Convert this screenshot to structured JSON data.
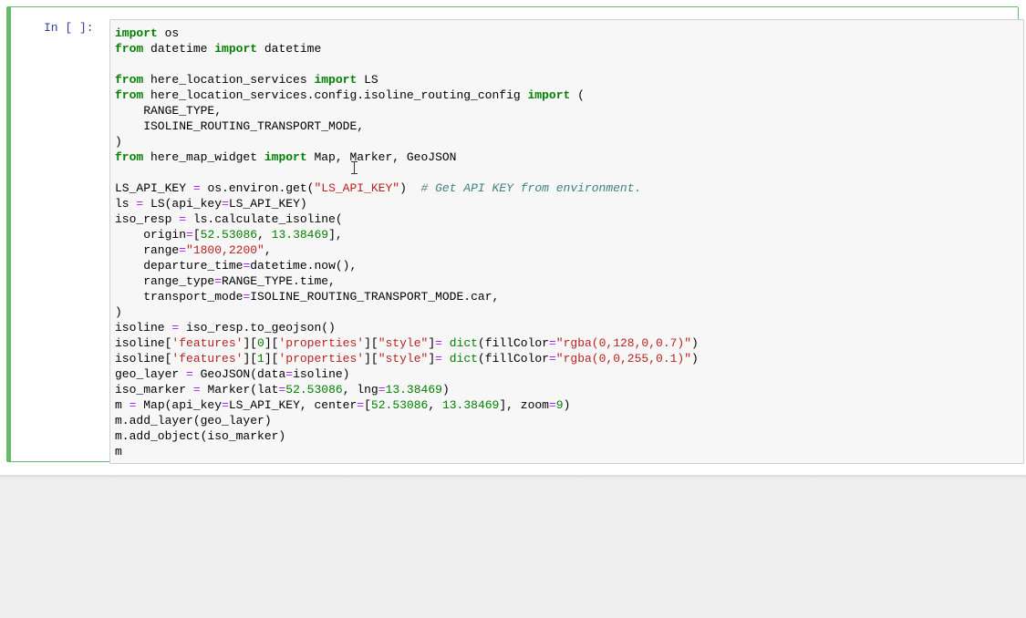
{
  "cell": {
    "prompt": "In [ ]:",
    "lines": [
      [
        [
          "keyword",
          "import"
        ],
        [
          "plain",
          " os"
        ]
      ],
      [
        [
          "keyword",
          "from"
        ],
        [
          "plain",
          " datetime "
        ],
        [
          "keyword",
          "import"
        ],
        [
          "plain",
          " datetime"
        ]
      ],
      [],
      [
        [
          "keyword",
          "from"
        ],
        [
          "plain",
          " here_location_services "
        ],
        [
          "keyword",
          "import"
        ],
        [
          "plain",
          " LS"
        ]
      ],
      [
        [
          "keyword",
          "from"
        ],
        [
          "plain",
          " here_location_services.config.isoline_routing_config "
        ],
        [
          "keyword",
          "import"
        ],
        [
          "plain",
          " ("
        ]
      ],
      [
        [
          "plain",
          "    RANGE_TYPE,"
        ]
      ],
      [
        [
          "plain",
          "    ISOLINE_ROUTING_TRANSPORT_MODE,"
        ]
      ],
      [
        [
          "plain",
          ")"
        ]
      ],
      [
        [
          "keyword",
          "from"
        ],
        [
          "plain",
          " here_map_widget "
        ],
        [
          "keyword",
          "import"
        ],
        [
          "plain",
          " Map, Marker, GeoJSON"
        ]
      ],
      [],
      [
        [
          "plain",
          "LS_API_KEY "
        ],
        [
          "op",
          "="
        ],
        [
          "plain",
          " os.environ.get("
        ],
        [
          "string",
          "\"LS_API_KEY\""
        ],
        [
          "plain",
          ")  "
        ],
        [
          "comment",
          "# Get API KEY from environment."
        ]
      ],
      [
        [
          "plain",
          "ls "
        ],
        [
          "op",
          "="
        ],
        [
          "plain",
          " LS(api_key"
        ],
        [
          "op",
          "="
        ],
        [
          "plain",
          "LS_API_KEY)"
        ]
      ],
      [
        [
          "plain",
          "iso_resp "
        ],
        [
          "op",
          "="
        ],
        [
          "plain",
          " ls.calculate_isoline("
        ]
      ],
      [
        [
          "plain",
          "    origin"
        ],
        [
          "op",
          "="
        ],
        [
          "plain",
          "["
        ],
        [
          "number",
          "52.53086"
        ],
        [
          "plain",
          ", "
        ],
        [
          "number",
          "13.38469"
        ],
        [
          "plain",
          "],"
        ]
      ],
      [
        [
          "plain",
          "    range"
        ],
        [
          "op",
          "="
        ],
        [
          "string",
          "\"1800,2200\""
        ],
        [
          "plain",
          ","
        ]
      ],
      [
        [
          "plain",
          "    departure_time"
        ],
        [
          "op",
          "="
        ],
        [
          "plain",
          "datetime.now(),"
        ]
      ],
      [
        [
          "plain",
          "    range_type"
        ],
        [
          "op",
          "="
        ],
        [
          "plain",
          "RANGE_TYPE.time,"
        ]
      ],
      [
        [
          "plain",
          "    transport_mode"
        ],
        [
          "op",
          "="
        ],
        [
          "plain",
          "ISOLINE_ROUTING_TRANSPORT_MODE.car,"
        ]
      ],
      [
        [
          "plain",
          ")"
        ]
      ],
      [
        [
          "plain",
          "isoline "
        ],
        [
          "op",
          "="
        ],
        [
          "plain",
          " iso_resp.to_geojson()"
        ]
      ],
      [
        [
          "plain",
          "isoline["
        ],
        [
          "string",
          "'features'"
        ],
        [
          "plain",
          "]["
        ],
        [
          "number",
          "0"
        ],
        [
          "plain",
          "]["
        ],
        [
          "string",
          "'properties'"
        ],
        [
          "plain",
          "]["
        ],
        [
          "string",
          "\"style\""
        ],
        [
          "plain",
          "]"
        ],
        [
          "op",
          "="
        ],
        [
          "plain",
          " "
        ],
        [
          "builtin",
          "dict"
        ],
        [
          "plain",
          "(fillColor"
        ],
        [
          "op",
          "="
        ],
        [
          "string",
          "\"rgba(0,128,0,0.7)\""
        ],
        [
          "plain",
          ")"
        ]
      ],
      [
        [
          "plain",
          "isoline["
        ],
        [
          "string",
          "'features'"
        ],
        [
          "plain",
          "]["
        ],
        [
          "number",
          "1"
        ],
        [
          "plain",
          "]["
        ],
        [
          "string",
          "'properties'"
        ],
        [
          "plain",
          "]["
        ],
        [
          "string",
          "\"style\""
        ],
        [
          "plain",
          "]"
        ],
        [
          "op",
          "="
        ],
        [
          "plain",
          " "
        ],
        [
          "builtin",
          "dict"
        ],
        [
          "plain",
          "(fillColor"
        ],
        [
          "op",
          "="
        ],
        [
          "string",
          "\"rgba(0,0,255,0.1)\""
        ],
        [
          "plain",
          ")"
        ]
      ],
      [
        [
          "plain",
          "geo_layer "
        ],
        [
          "op",
          "="
        ],
        [
          "plain",
          " GeoJSON(data"
        ],
        [
          "op",
          "="
        ],
        [
          "plain",
          "isoline)"
        ]
      ],
      [
        [
          "plain",
          "iso_marker "
        ],
        [
          "op",
          "="
        ],
        [
          "plain",
          " Marker(lat"
        ],
        [
          "op",
          "="
        ],
        [
          "number",
          "52.53086"
        ],
        [
          "plain",
          ", lng"
        ],
        [
          "op",
          "="
        ],
        [
          "number",
          "13.38469"
        ],
        [
          "plain",
          ")"
        ]
      ],
      [
        [
          "plain",
          "m "
        ],
        [
          "op",
          "="
        ],
        [
          "plain",
          " Map(api_key"
        ],
        [
          "op",
          "="
        ],
        [
          "plain",
          "LS_API_KEY, center"
        ],
        [
          "op",
          "="
        ],
        [
          "plain",
          "["
        ],
        [
          "number",
          "52.53086"
        ],
        [
          "plain",
          ", "
        ],
        [
          "number",
          "13.38469"
        ],
        [
          "plain",
          "], zoom"
        ],
        [
          "op",
          "="
        ],
        [
          "number",
          "9"
        ],
        [
          "plain",
          ")"
        ]
      ],
      [
        [
          "plain",
          "m.add_layer(geo_layer)"
        ]
      ],
      [
        [
          "plain",
          "m.add_object(iso_marker)"
        ]
      ],
      [
        [
          "plain",
          "m"
        ]
      ]
    ]
  },
  "colors": {
    "cell_border": "#66bb6a",
    "prompt": "#303f9f",
    "keyword": "#008000",
    "operator": "#aa22ff",
    "string": "#ba2121",
    "comment": "#408080"
  },
  "icons": {
    "cursor": "text-cursor-icon"
  }
}
